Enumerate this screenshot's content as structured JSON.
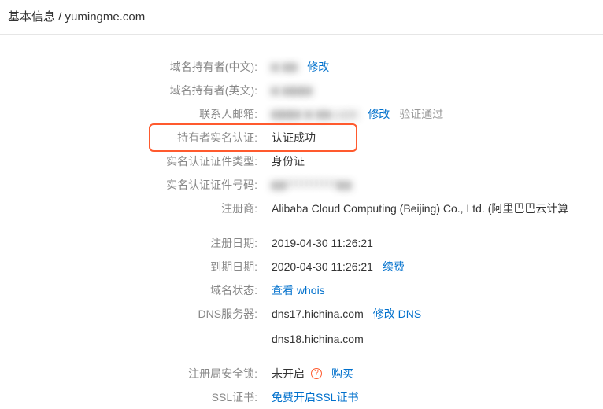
{
  "header": {
    "prefix": "基本信息",
    "sep": " / ",
    "domain": "yumingme.com"
  },
  "rows": {
    "holder_cn": {
      "label": "域名持有者(中文):",
      "value": "■ ■■",
      "modify": "修改"
    },
    "holder_en": {
      "label": "域名持有者(英文):",
      "value": "■ ■■■■"
    },
    "email": {
      "label": "联系人邮箱:",
      "value": "■■■■ ■ ■■.com",
      "modify": "修改",
      "verified": "验证通过"
    },
    "realname": {
      "label": "持有者实名认证:",
      "value": "认证成功"
    },
    "cert_type": {
      "label": "实名认证证件类型:",
      "value": "身份证"
    },
    "cert_no": {
      "label": "实名认证证件号码:",
      "value": "■■**********■■"
    },
    "registrar": {
      "label": "注册商:",
      "value": "Alibaba Cloud Computing (Beijing) Co., Ltd. (阿里巴巴云计算"
    },
    "reg_date": {
      "label": "注册日期:",
      "value": "2019-04-30 11:26:21"
    },
    "exp_date": {
      "label": "到期日期:",
      "value": "2020-04-30 11:26:21",
      "renew": "续费"
    },
    "status": {
      "label": "域名状态:",
      "whois": "查看 whois"
    },
    "dns": {
      "label": "DNS服务器:",
      "value1": "dns17.hichina.com",
      "modify": "修改 DNS",
      "value2": "dns18.hichina.com"
    },
    "lock": {
      "label": "注册局安全锁:",
      "value": "未开启",
      "buy": "购买"
    },
    "ssl": {
      "label": "SSL证书:",
      "enable": "免费开启SSL证书"
    }
  }
}
